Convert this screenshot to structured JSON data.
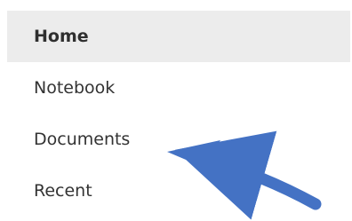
{
  "nav": {
    "items": [
      {
        "label": "Home",
        "selected": true
      },
      {
        "label": "Notebook",
        "selected": false
      },
      {
        "label": "Documents",
        "selected": false
      },
      {
        "label": "Recent",
        "selected": false
      }
    ]
  },
  "annotation": {
    "icon": "arrow-icon",
    "color": "#4472c4",
    "target": "Documents"
  }
}
